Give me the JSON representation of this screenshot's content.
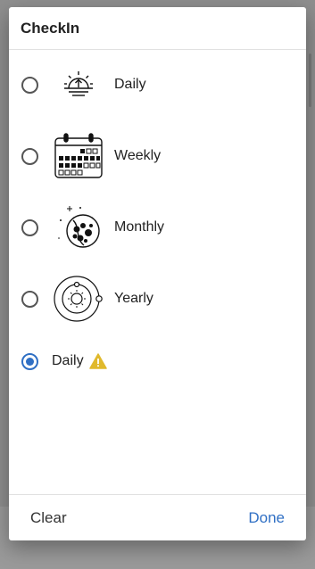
{
  "dialog": {
    "title": "CheckIn",
    "options": [
      {
        "label": "Daily",
        "icon": "sunrise-icon",
        "checked": false
      },
      {
        "label": "Weekly",
        "icon": "calendar-icon",
        "checked": false
      },
      {
        "label": "Monthly",
        "icon": "moon-icon",
        "checked": false
      },
      {
        "label": "Yearly",
        "icon": "orbit-icon",
        "checked": false
      }
    ],
    "selected": {
      "label": "Daily",
      "icon": "warning-icon",
      "checked": true
    },
    "clear_label": "Clear",
    "done_label": "Done"
  },
  "colors": {
    "accent": "#2f6fc4",
    "warning": "#e0b92c"
  }
}
